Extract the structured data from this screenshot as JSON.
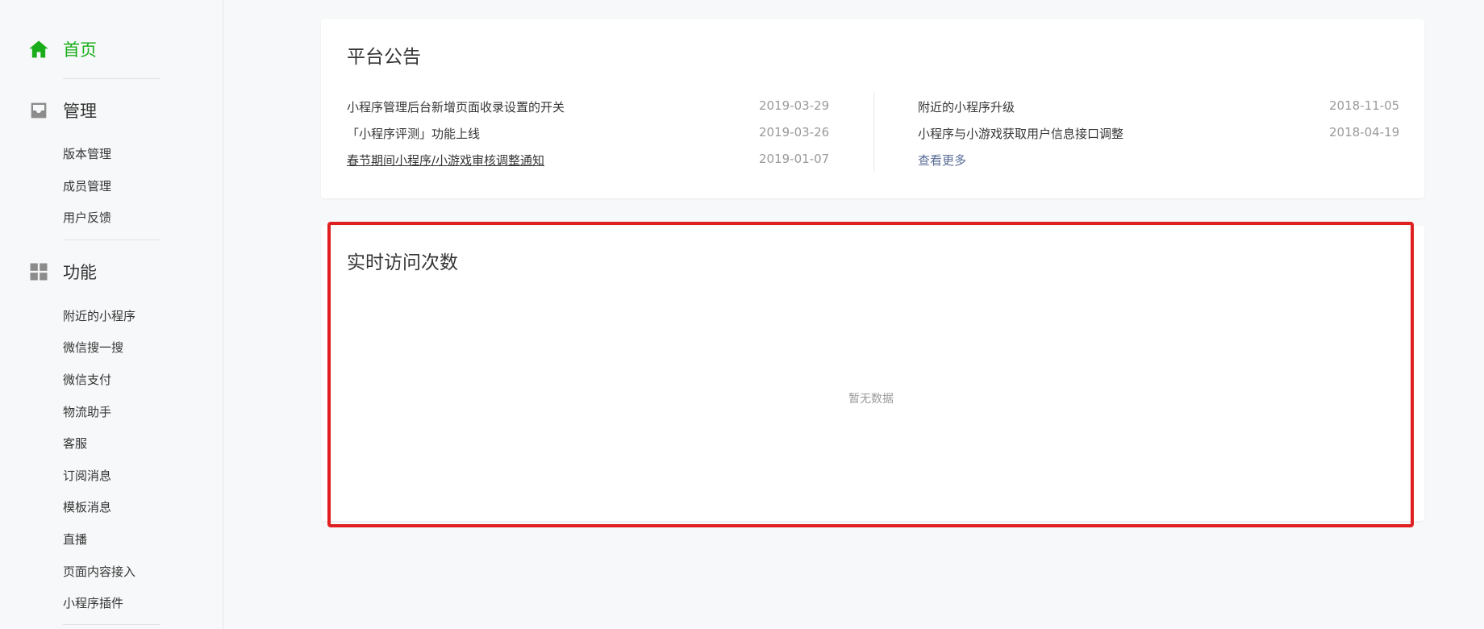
{
  "sidebar": {
    "home": {
      "label": "首页",
      "icon": "home-icon",
      "color": "#1aad19"
    },
    "manage": {
      "label": "管理",
      "icon": "inbox-icon",
      "items": [
        {
          "label": "版本管理"
        },
        {
          "label": "成员管理"
        },
        {
          "label": "用户反馈"
        }
      ]
    },
    "features": {
      "label": "功能",
      "icon": "grid-icon",
      "items": [
        {
          "label": "附近的小程序"
        },
        {
          "label": "微信搜一搜"
        },
        {
          "label": "微信支付"
        },
        {
          "label": "物流助手"
        },
        {
          "label": "客服"
        },
        {
          "label": "订阅消息"
        },
        {
          "label": "模板消息"
        },
        {
          "label": "直播"
        },
        {
          "label": "页面内容接入"
        },
        {
          "label": "小程序插件"
        }
      ]
    }
  },
  "announcements": {
    "title": "平台公告",
    "left": [
      {
        "text": "小程序管理后台新增页面收录设置的开关",
        "date": "2019-03-29"
      },
      {
        "text": "「小程序评测」功能上线",
        "date": "2019-03-26"
      },
      {
        "text": "春节期间小程序/小游戏审核调整通知",
        "date": "2019-01-07"
      }
    ],
    "right": [
      {
        "text": "附近的小程序升级",
        "date": "2018-11-05"
      },
      {
        "text": "小程序与小游戏获取用户信息接口调整",
        "date": "2018-04-19"
      }
    ],
    "more_label": "查看更多"
  },
  "realtime": {
    "title": "实时访问次数",
    "empty_text": "暂无数据"
  },
  "colors": {
    "accent": "#1aad19",
    "link": "#576b95",
    "highlight": "#e02020"
  }
}
